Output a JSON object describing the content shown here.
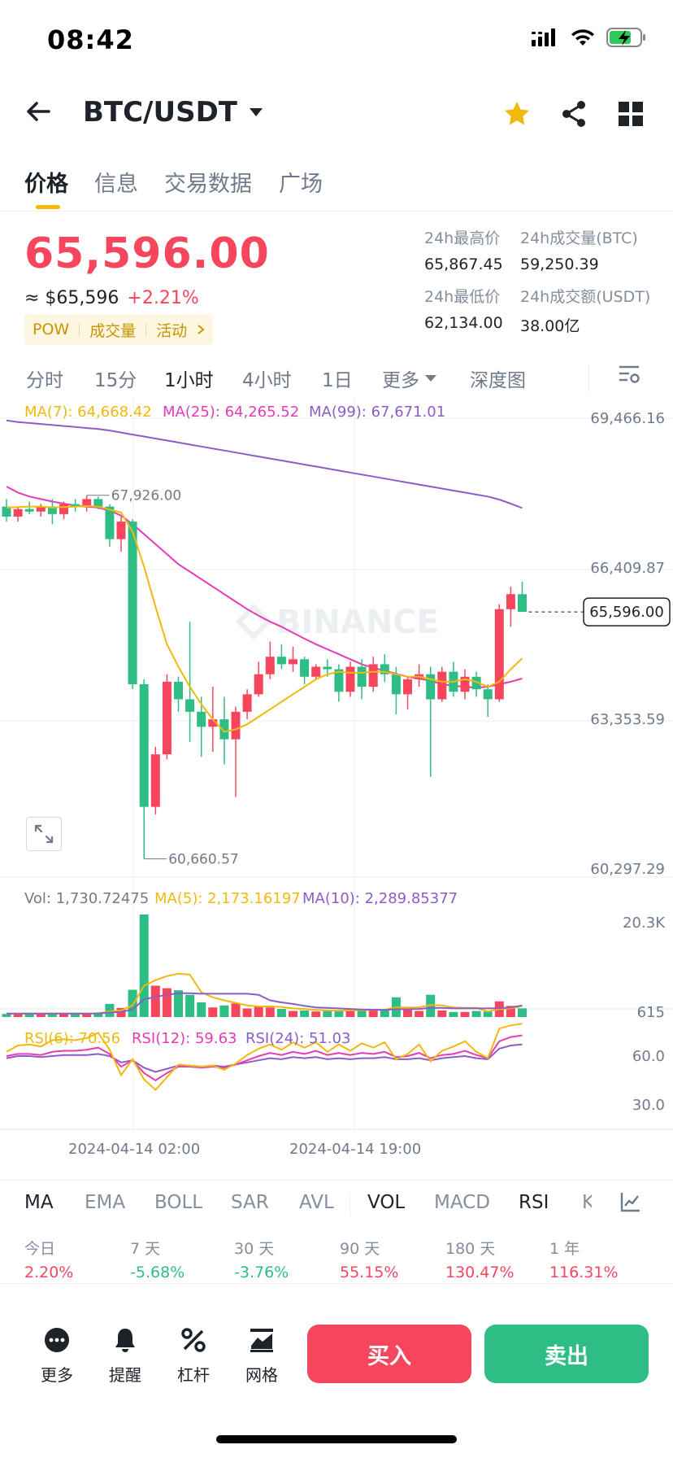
{
  "status_bar": {
    "time": "08:42"
  },
  "header": {
    "pair": "BTC/USDT"
  },
  "tabs": [
    {
      "label": "价格",
      "active": true
    },
    {
      "label": "信息",
      "active": false
    },
    {
      "label": "交易数据",
      "active": false
    },
    {
      "label": "广场",
      "active": false
    }
  ],
  "ticker": {
    "price": "65,596.00",
    "usd_approx": "≈ $65,596",
    "change_pct": "+2.21%",
    "tags": [
      "POW",
      "成交量",
      "活动"
    ],
    "high_label": "24h最高价",
    "high": "65,867.45",
    "vol_btc_label": "24h成交量(BTC)",
    "vol_btc": "59,250.39",
    "low_label": "24h最低价",
    "low": "62,134.00",
    "vol_usdt_label": "24h成交额(USDT)",
    "vol_usdt": "38.00亿"
  },
  "intervals": [
    {
      "label": "分时",
      "active": false
    },
    {
      "label": "15分",
      "active": false
    },
    {
      "label": "1小时",
      "active": true
    },
    {
      "label": "4小时",
      "active": false
    },
    {
      "label": "1日",
      "active": false
    },
    {
      "label": "更多",
      "active": false
    },
    {
      "label": "深度图",
      "active": false
    }
  ],
  "colors": {
    "up": "#f6465d",
    "down": "#2ebd85",
    "accent": "#f0b90b",
    "ma7": "#f0b90b",
    "ma25": "#e53bb5",
    "ma99": "#8c5cc7"
  },
  "chart_data": {
    "type": "candlestick",
    "watermark": "BINANCE",
    "price_axis": [
      "69,466.16",
      "66,409.87",
      "63,353.59",
      "60,297.29"
    ],
    "price_ylim": [
      60297.29,
      69466.16
    ],
    "current_price_tag": "65,596.00",
    "high_marker": "67,926.00",
    "low_marker": "60,660.57",
    "ma_legend": {
      "ma7": "MA(7): 64,668.42",
      "ma25": "MA(25): 64,265.52",
      "ma99": "MA(99): 67,671.01"
    },
    "candles": [
      [
        67700,
        67850,
        67400,
        67500
      ],
      [
        67500,
        67700,
        67400,
        67650
      ],
      [
        67650,
        67800,
        67550,
        67600
      ],
      [
        67600,
        67750,
        67500,
        67700
      ],
      [
        67700,
        67850,
        67350,
        67550
      ],
      [
        67550,
        67800,
        67450,
        67750
      ],
      [
        67750,
        67850,
        67600,
        67700
      ],
      [
        67700,
        67926,
        67600,
        67850
      ],
      [
        67850,
        67900,
        67650,
        67700
      ],
      [
        67700,
        67750,
        66900,
        67050
      ],
      [
        67050,
        67500,
        66800,
        67400
      ],
      [
        67400,
        67450,
        64050,
        64150
      ],
      [
        64150,
        64250,
        60660.57,
        61700
      ],
      [
        61700,
        62900,
        61550,
        62750
      ],
      [
        62750,
        64350,
        62650,
        64200
      ],
      [
        64200,
        64300,
        63600,
        63850
      ],
      [
        63850,
        65400,
        63000,
        63600
      ],
      [
        63600,
        63900,
        62700,
        63300
      ],
      [
        63300,
        64100,
        62800,
        63450
      ],
      [
        63450,
        63900,
        62550,
        63050
      ],
      [
        63050,
        63700,
        61900,
        63600
      ],
      [
        63600,
        64050,
        63450,
        63950
      ],
      [
        63950,
        64600,
        63900,
        64350
      ],
      [
        64350,
        65000,
        64250,
        64700
      ],
      [
        64700,
        64950,
        64450,
        64550
      ],
      [
        64550,
        64900,
        64400,
        64650
      ],
      [
        64650,
        64700,
        64150,
        64300
      ],
      [
        64300,
        64550,
        64250,
        64500
      ],
      [
        64500,
        64650,
        64300,
        64450
      ],
      [
        64450,
        64550,
        63800,
        64000
      ],
      [
        64000,
        64600,
        63900,
        64500
      ],
      [
        64500,
        64650,
        63850,
        64100
      ],
      [
        64100,
        64700,
        64000,
        64550
      ],
      [
        64550,
        64750,
        64200,
        64350
      ],
      [
        64350,
        64500,
        63550,
        63950
      ],
      [
        63950,
        64300,
        63650,
        64250
      ],
      [
        64250,
        64550,
        64100,
        64350
      ],
      [
        64350,
        64500,
        62300,
        63850
      ],
      [
        63850,
        64500,
        63800,
        64400
      ],
      [
        64400,
        64600,
        63900,
        64000
      ],
      [
        64000,
        64450,
        63850,
        64300
      ],
      [
        64300,
        64400,
        63900,
        64050
      ],
      [
        64050,
        64150,
        63500,
        63850
      ],
      [
        63850,
        65750,
        63800,
        65650
      ],
      [
        65650,
        66100,
        65300,
        65950
      ],
      [
        65950,
        66200,
        65650,
        65596
      ]
    ],
    "ma7": [
      67680,
      67690,
      67700,
      67700,
      67680,
      67690,
      67700,
      67710,
      67700,
      67640,
      67580,
      67200,
      66500,
      65700,
      64950,
      64500,
      64100,
      63750,
      63450,
      63200,
      63250,
      63350,
      63500,
      63650,
      63800,
      63950,
      64100,
      64250,
      64350,
      64400,
      64380,
      64380,
      64400,
      64400,
      64350,
      64300,
      64300,
      64250,
      64200,
      64200,
      64250,
      64200,
      64100,
      64200,
      64450,
      64668.42
    ],
    "ma25": [
      68100,
      67980,
      67900,
      67850,
      67800,
      67760,
      67720,
      67700,
      67680,
      67620,
      67520,
      67350,
      67150,
      66950,
      66750,
      66550,
      66400,
      66250,
      66100,
      65950,
      65800,
      65650,
      65520,
      65400,
      65300,
      65180,
      65060,
      64950,
      64850,
      64750,
      64650,
      64550,
      64480,
      64420,
      64360,
      64300,
      64260,
      64220,
      64150,
      64120,
      64100,
      64080,
      64100,
      64150,
      64200,
      64265.52
    ],
    "ma99": [
      69420,
      69390,
      69370,
      69350,
      69330,
      69310,
      69290,
      69270,
      69250,
      69220,
      69180,
      69140,
      69100,
      69060,
      69020,
      68980,
      68940,
      68900,
      68860,
      68820,
      68780,
      68740,
      68700,
      68660,
      68620,
      68580,
      68540,
      68500,
      68460,
      68420,
      68380,
      68340,
      68300,
      68260,
      68220,
      68180,
      68140,
      68100,
      68060,
      68020,
      67980,
      67940,
      67900,
      67840,
      67760,
      67671.01
    ],
    "volume_legend": {
      "vol": "Vol: 1,730.72475",
      "ma5": "MA(5): 2,173.16197",
      "ma10": "MA(10): 2,289.85377"
    },
    "volume_axis": [
      "20.3K",
      "615"
    ],
    "volume_max": 20300,
    "volume": [
      600,
      700,
      650,
      700,
      600,
      650,
      700,
      700,
      900,
      2600,
      1800,
      5400,
      20300,
      6200,
      5700,
      5300,
      4400,
      2900,
      1900,
      2300,
      2700,
      1700,
      2100,
      1900,
      1600,
      1200,
      1300,
      1100,
      1300,
      1400,
      1300,
      1600,
      1500,
      1400,
      3900,
      1600,
      1200,
      4400,
      1300,
      1000,
      1000,
      1200,
      1100,
      3100,
      2200,
      1730.72
    ],
    "vol_ma5": [
      650,
      660,
      670,
      680,
      660,
      670,
      680,
      690,
      720,
      1100,
      1300,
      2300,
      6200,
      7300,
      8100,
      8600,
      8400,
      4900,
      3900,
      3300,
      2800,
      2300,
      2100,
      2100,
      2000,
      1700,
      1600,
      1400,
      1300,
      1250,
      1300,
      1350,
      1400,
      1450,
      1900,
      1900,
      1900,
      2400,
      2300,
      1900,
      1800,
      1800,
      1100,
      1600,
      1700,
      2173.16
    ],
    "vol_ma10": [
      700,
      700,
      700,
      700,
      700,
      700,
      700,
      700,
      710,
      900,
      1000,
      1500,
      3500,
      4000,
      4400,
      4700,
      4700,
      4600,
      4600,
      4600,
      4600,
      4600,
      4400,
      3300,
      2900,
      2600,
      2200,
      1900,
      1800,
      1700,
      1600,
      1500,
      1450,
      1400,
      1550,
      1550,
      1600,
      1800,
      1800,
      1700,
      1700,
      1700,
      1700,
      1750,
      1900,
      2289.85
    ],
    "rsi_legend": {
      "rsi6": "RSI(6): 70.56",
      "rsi12": "RSI(12): 59.63",
      "rsi24": "RSI(24): 51.03"
    },
    "rsi_axis": [
      "60.0",
      "30.0"
    ],
    "rsi6": [
      44,
      50,
      51,
      49,
      55,
      56,
      55,
      57,
      62,
      46,
      22,
      37,
      18,
      8,
      20,
      32,
      31,
      30,
      31,
      27,
      33,
      41,
      47,
      51,
      46,
      53,
      48,
      53,
      44,
      51,
      45,
      52,
      48,
      53,
      37,
      42,
      51,
      35,
      45,
      49,
      54,
      44,
      38,
      66,
      69,
      70.56
    ],
    "rsi12": [
      40,
      42,
      42,
      41,
      44,
      45,
      45,
      46,
      48,
      42,
      30,
      36,
      24,
      17,
      24,
      30,
      30,
      29,
      30,
      29,
      32,
      36,
      40,
      43,
      41,
      44,
      42,
      45,
      41,
      43,
      41,
      43,
      42,
      44,
      39,
      40,
      43,
      38,
      41,
      42,
      45,
      41,
      38,
      54,
      58,
      59.63
    ],
    "rsi24": [
      38,
      40,
      40,
      39,
      40,
      41,
      41,
      41,
      42,
      40,
      34,
      36,
      29,
      25,
      28,
      31,
      31,
      30,
      31,
      30,
      32,
      34,
      36,
      38,
      37,
      39,
      38,
      39,
      37,
      38,
      37,
      38,
      38,
      39,
      37,
      37,
      38,
      36,
      38,
      39,
      40,
      38,
      37,
      47,
      50,
      51.03
    ],
    "time_labels": [
      "2024-04-14 02:00",
      "2024-04-14 19:00"
    ]
  },
  "indicators": [
    {
      "label": "MA",
      "active": true
    },
    {
      "label": "EMA",
      "active": false
    },
    {
      "label": "BOLL",
      "active": false
    },
    {
      "label": "SAR",
      "active": false
    },
    {
      "label": "AVL",
      "active": false
    },
    {
      "label": "VOL",
      "active": true
    },
    {
      "label": "MACD",
      "active": false
    },
    {
      "label": "RSI",
      "active": true
    },
    {
      "label": "K",
      "active": false
    }
  ],
  "performance": [
    {
      "label": "今日",
      "value": "2.20%",
      "dir": "up"
    },
    {
      "label": "7 天",
      "value": "-5.68%",
      "dir": "down"
    },
    {
      "label": "30 天",
      "value": "-3.76%",
      "dir": "down"
    },
    {
      "label": "90 天",
      "value": "55.15%",
      "dir": "up"
    },
    {
      "label": "180 天",
      "value": "130.47%",
      "dir": "up"
    },
    {
      "label": "1 年",
      "value": "116.31%",
      "dir": "up"
    }
  ],
  "bottom_bar": {
    "more": "更多",
    "alert": "提醒",
    "margin": "杠杆",
    "grid": "网格",
    "buy": "买入",
    "sell": "卖出"
  }
}
